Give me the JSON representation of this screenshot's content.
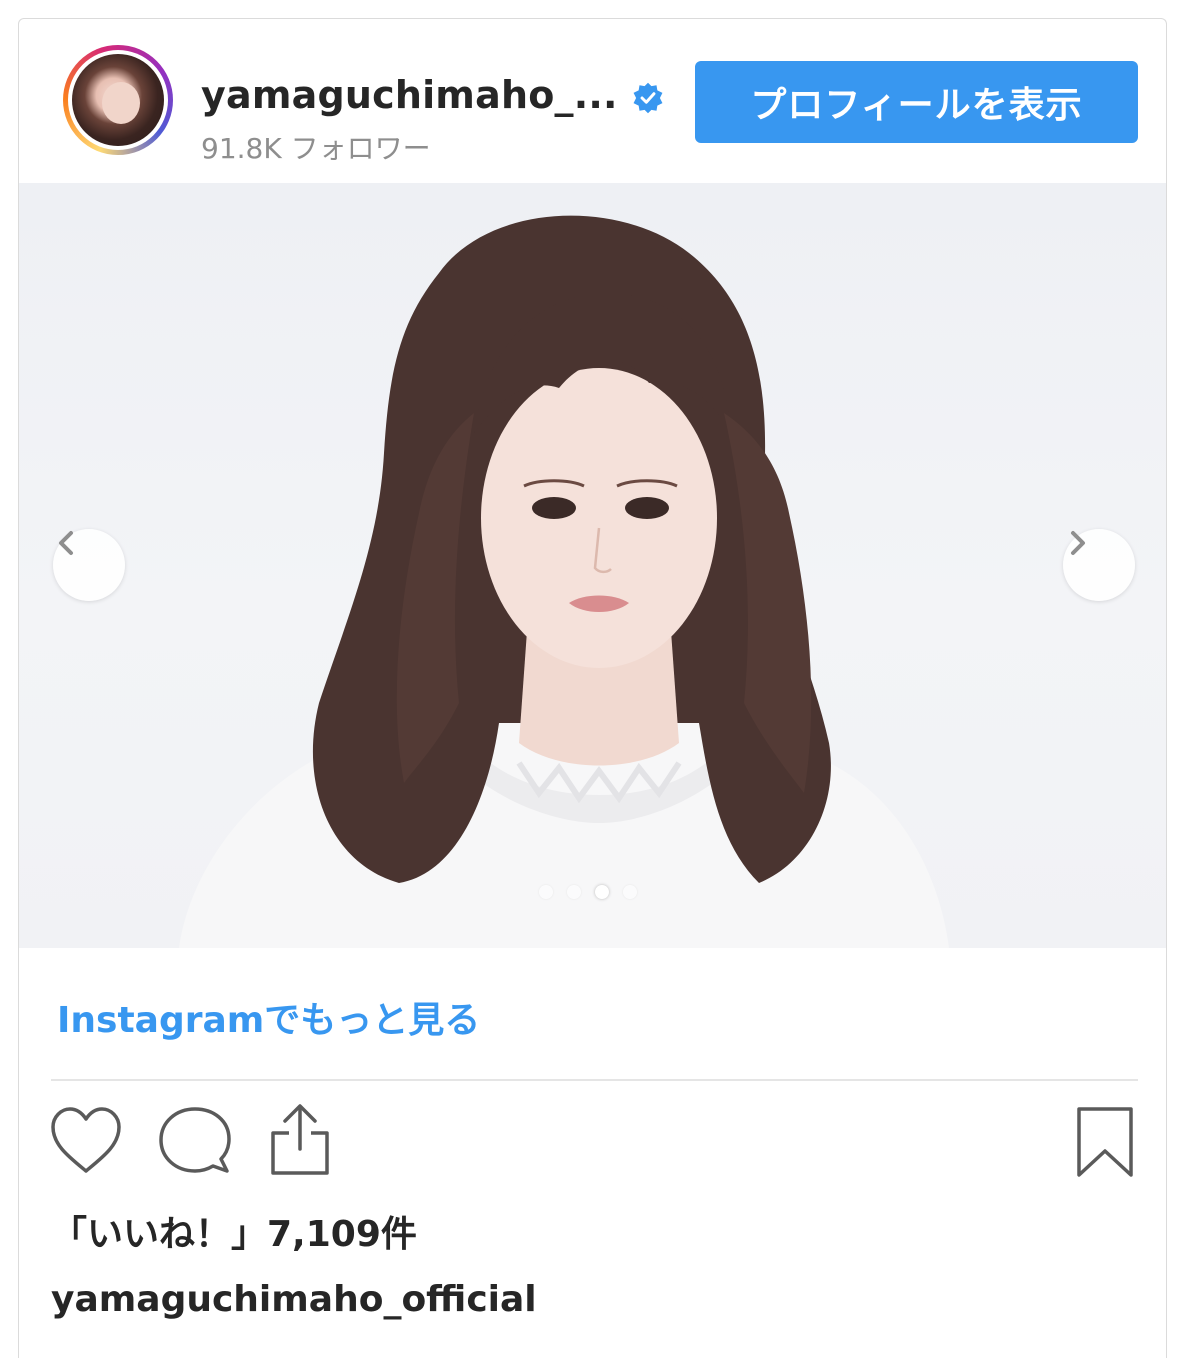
{
  "header": {
    "username": "yamaguchimaho_...",
    "followers": "91.8K フォロワー",
    "view_profile_label": "プロフィールを表示"
  },
  "carousel": {
    "slide_count": 4,
    "active_index": 2
  },
  "footer": {
    "more_link": "Instagramでもっと見る",
    "likes": "「いいね！」7,109件",
    "caption_username": "yamaguchimaho_official"
  },
  "colors": {
    "accent": "#3897f0",
    "text": "#262626",
    "muted": "#8e8e8e"
  }
}
